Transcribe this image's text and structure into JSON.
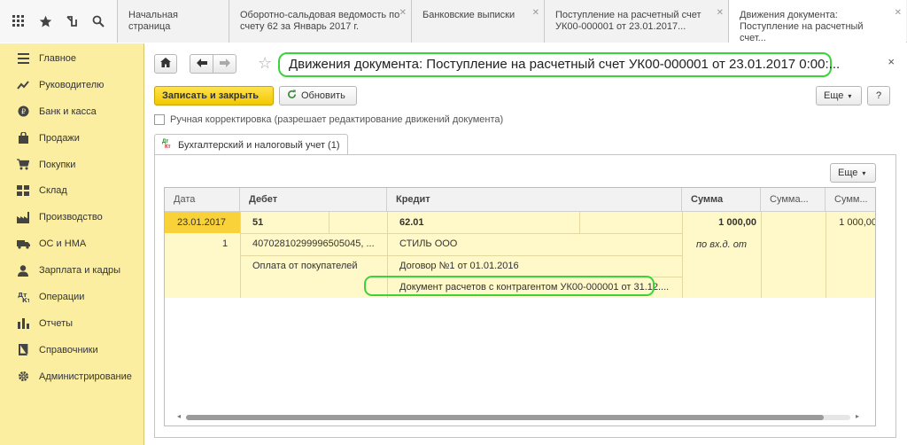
{
  "tabs": [
    {
      "label": "Начальная страница",
      "closable": false
    },
    {
      "label": "Оборотно-сальдовая ведомость по счету 62 за Январь 2017 г.",
      "closable": true
    },
    {
      "label": "Банковские выписки",
      "closable": true
    },
    {
      "label": "Поступление на расчетный счет УК00-000001 от 23.01.2017...",
      "closable": true
    },
    {
      "label": "Движения документа: Поступление на расчетный счет...",
      "closable": true,
      "active": true
    }
  ],
  "sidebar": {
    "items": [
      {
        "label": "Главное",
        "icon": "menu-lines-icon"
      },
      {
        "label": "Руководителю",
        "icon": "chart-line-icon"
      },
      {
        "label": "Банк и касса",
        "icon": "coin-icon"
      },
      {
        "label": "Продажи",
        "icon": "bag-icon"
      },
      {
        "label": "Покупки",
        "icon": "cart-icon"
      },
      {
        "label": "Склад",
        "icon": "warehouse-icon"
      },
      {
        "label": "Производство",
        "icon": "factory-icon"
      },
      {
        "label": "ОС и НМА",
        "icon": "truck-icon"
      },
      {
        "label": "Зарплата и кадры",
        "icon": "person-icon"
      },
      {
        "label": "Операции",
        "icon": "operations-icon"
      },
      {
        "label": "Отчеты",
        "icon": "bar-chart-icon"
      },
      {
        "label": "Справочники",
        "icon": "book-icon"
      },
      {
        "label": "Администрирование",
        "icon": "gear-icon"
      }
    ]
  },
  "header": {
    "title": "Движения документа: Поступление на расчетный счет УК00-000001 от 23.01.2017 0:00:...",
    "close": "×"
  },
  "toolbar": {
    "save_close": "Записать и закрыть",
    "refresh": "Обновить",
    "more": "Еще",
    "help": "?"
  },
  "manual": {
    "label": "Ручная корректировка (разрешает редактирование движений документа)"
  },
  "subtab": {
    "label": "Бухгалтерский и налоговый учет (1)",
    "icon_text": "Дт Кт"
  },
  "grid": {
    "more": "Еще",
    "headers": [
      "Дата",
      "Дебет",
      "Кредит",
      "Сумма",
      "Сумма...",
      "Сумм..."
    ],
    "row": {
      "date": "23.01.2017",
      "number": "1",
      "debit_account": "51",
      "debit_sub1": "40702810299996505045, ...",
      "debit_sub2": "Оплата от покупателей",
      "credit_account": "62.01",
      "credit_sub1": "СТИЛЬ ООО",
      "credit_sub2": "Договор №1 от 01.01.2016",
      "credit_sub3": "Документ расчетов с контрагентом УК00-000001 от 31.12....",
      "sum": "1 000,00",
      "sum_note": "по вх.д. от",
      "sum3": "1 000,00"
    }
  }
}
